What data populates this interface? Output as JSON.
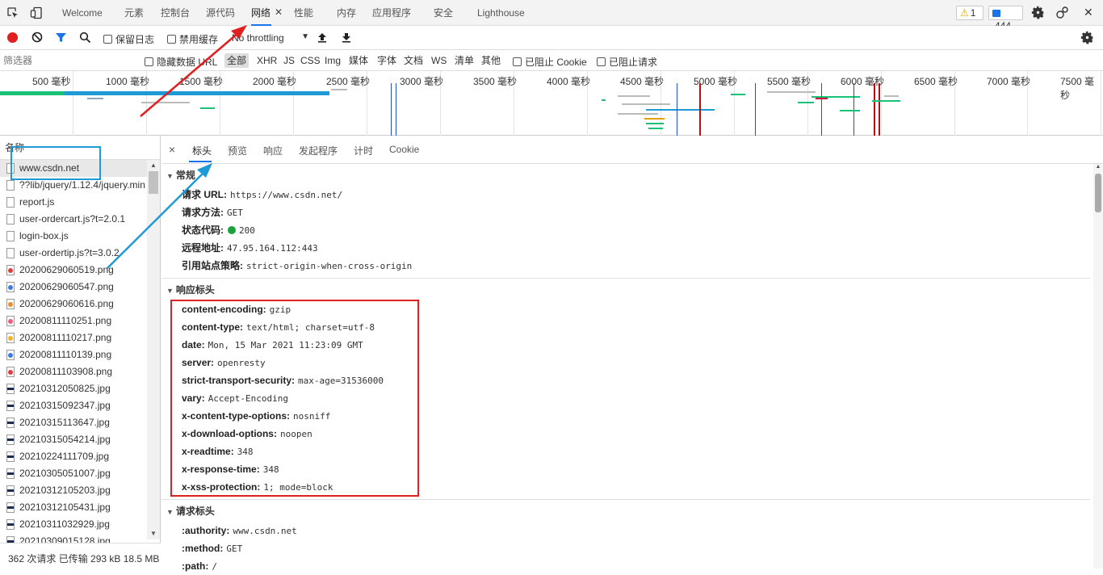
{
  "tabs": [
    {
      "label": "Welcome"
    },
    {
      "label": "元素"
    },
    {
      "label": "控制台"
    },
    {
      "label": "源代码"
    },
    {
      "label": "网络"
    },
    {
      "label": "性能"
    },
    {
      "label": "内存"
    },
    {
      "label": "应用程序"
    },
    {
      "label": "安全"
    },
    {
      "label": "Lighthouse"
    }
  ],
  "tab_close": "✕",
  "badges": {
    "warnings": "1",
    "messages": "444"
  },
  "toolbar": {
    "preserve_log": "保留日志",
    "disable_cache": "禁用缓存",
    "throttling": "No throttling"
  },
  "filter": {
    "placeholder": "筛选器",
    "hide_data_url": "隐藏数据 URL",
    "types": [
      "全部",
      "XHR",
      "JS",
      "CSS",
      "Img",
      "媒体",
      "字体",
      "文档",
      "WS",
      "清单",
      "其他"
    ],
    "blocked_cookies": "已阻止 Cookie",
    "blocked_requests": "已阻止请求"
  },
  "timeline_ticks": [
    "500 毫秒",
    "1000 毫秒",
    "1500 毫秒",
    "2000 毫秒",
    "2500 毫秒",
    "3000 毫秒",
    "3500 毫秒",
    "4000 毫秒",
    "4500 毫秒",
    "5000 毫秒",
    "5500 毫秒",
    "6000 毫秒",
    "6500 毫秒",
    "7000 毫秒",
    "7500 毫秒"
  ],
  "request_list": {
    "header": "名称",
    "items": [
      {
        "name": "www.csdn.net",
        "icon": "document"
      },
      {
        "name": "??lib/jquery/1.12.4/jquery.min",
        "icon": "document"
      },
      {
        "name": "report.js",
        "icon": "document"
      },
      {
        "name": "user-ordercart.js?t=2.0.1",
        "icon": "document"
      },
      {
        "name": "login-box.js",
        "icon": "document"
      },
      {
        "name": "user-ordertip.js?t=3.0.2",
        "icon": "document"
      },
      {
        "name": "20200629060519.png",
        "icon": "image-red"
      },
      {
        "name": "20200629060547.png",
        "icon": "image-blue"
      },
      {
        "name": "20200629060616.png",
        "icon": "image-orange"
      },
      {
        "name": "20200811110251.png",
        "icon": "image-pink"
      },
      {
        "name": "20200811110217.png",
        "icon": "image-yellow"
      },
      {
        "name": "20200811110139.png",
        "icon": "image-blue"
      },
      {
        "name": "20200811103908.png",
        "icon": "image-red"
      },
      {
        "name": "20210312050825.jpg",
        "icon": "image-dark"
      },
      {
        "name": "20210315092347.jpg",
        "icon": "image-dark"
      },
      {
        "name": "20210315113647.jpg",
        "icon": "image-dark"
      },
      {
        "name": "20210315054214.jpg",
        "icon": "image-dark"
      },
      {
        "name": "20210224111709.jpg",
        "icon": "image-dark"
      },
      {
        "name": "20210305051007.jpg",
        "icon": "image-dark"
      },
      {
        "name": "20210312105203.jpg",
        "icon": "image-dark"
      },
      {
        "name": "20210312105431.jpg",
        "icon": "image-dark"
      },
      {
        "name": "20210311032929.jpg",
        "icon": "image-dark"
      },
      {
        "name": "20210309015128.jpg",
        "icon": "image-dark"
      }
    ],
    "footer": "362 次请求 已传输 293 kB 18.5 MB"
  },
  "detail": {
    "close": "×",
    "tabs": [
      "标头",
      "预览",
      "响应",
      "发起程序",
      "计时",
      "Cookie"
    ],
    "general": {
      "title": "常规",
      "fields": [
        {
          "key": "请求 URL:",
          "value": "https://www.csdn.net/"
        },
        {
          "key": "请求方法:",
          "value": "GET"
        },
        {
          "key": "状态代码:",
          "value": "200"
        },
        {
          "key": "远程地址:",
          "value": "47.95.164.112:443"
        },
        {
          "key": "引用站点策略:",
          "value": "strict-origin-when-cross-origin"
        }
      ]
    },
    "response_headers": {
      "title": "响应标头",
      "fields": [
        {
          "key": "content-encoding:",
          "value": "gzip"
        },
        {
          "key": "content-type:",
          "value": "text/html; charset=utf-8"
        },
        {
          "key": "date:",
          "value": "Mon, 15 Mar 2021 11:23:09 GMT"
        },
        {
          "key": "server:",
          "value": "openresty"
        },
        {
          "key": "strict-transport-security:",
          "value": "max-age=31536000"
        },
        {
          "key": "vary:",
          "value": "Accept-Encoding"
        },
        {
          "key": "x-content-type-options:",
          "value": "nosniff"
        },
        {
          "key": "x-download-options:",
          "value": "noopen"
        },
        {
          "key": "x-readtime:",
          "value": "348"
        },
        {
          "key": "x-response-time:",
          "value": "348"
        },
        {
          "key": "x-xss-protection:",
          "value": "1; mode=block"
        }
      ]
    },
    "request_headers": {
      "title": "请求标头",
      "fields": [
        {
          "key": ":authority:",
          "value": "www.csdn.net"
        },
        {
          "key": ":method:",
          "value": "GET"
        },
        {
          "key": ":path:",
          "value": "/"
        }
      ]
    }
  },
  "colors": {
    "accent": "#1a73e8",
    "record": "#e0201f",
    "status_ok": "#1aa13c",
    "annotation_red": "#e02020",
    "annotation_blue": "#1e9bd7"
  }
}
